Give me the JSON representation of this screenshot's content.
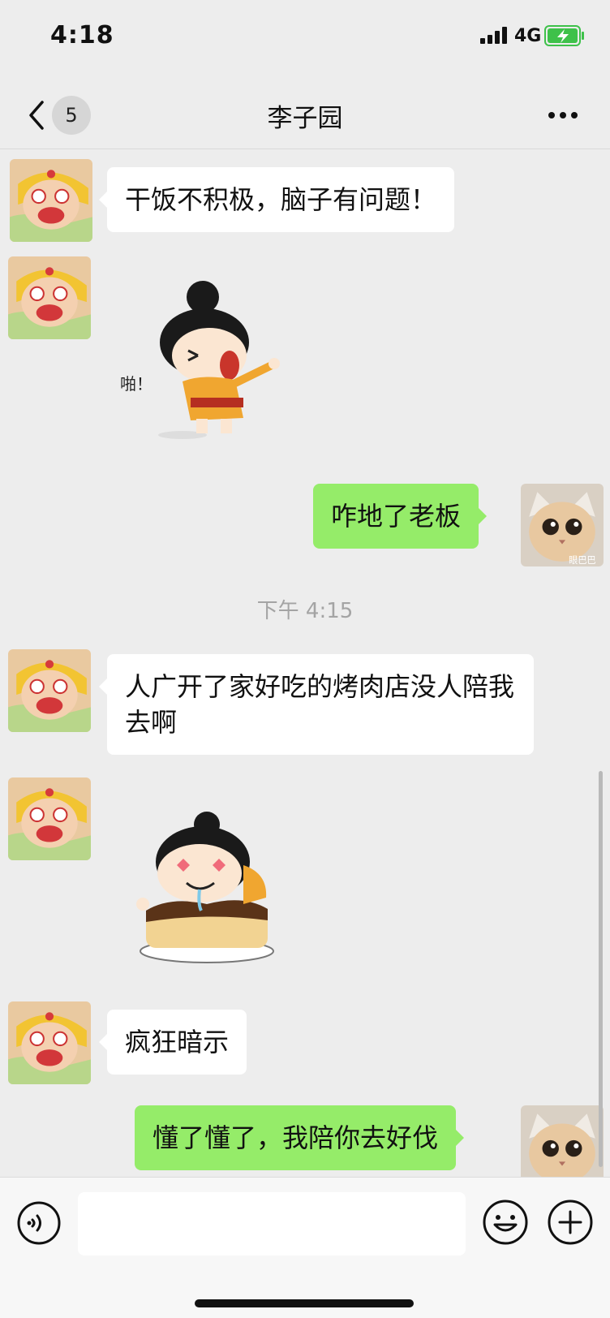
{
  "status_bar": {
    "time": "4:18",
    "network": "4G"
  },
  "nav": {
    "unread_count": "5",
    "title": "李子园"
  },
  "messages": [
    {
      "side": "left",
      "type": "text",
      "text": "干饭不积极，脑子有问题！"
    },
    {
      "side": "left",
      "type": "sticker",
      "icon": "slap-cartoon-sticker",
      "caption": "啪！"
    },
    {
      "side": "right",
      "type": "text",
      "text": "咋地了老板"
    },
    {
      "side": "left",
      "type": "text",
      "text": "人广开了家好吃的烤肉店没人陪我去啊"
    },
    {
      "side": "left",
      "type": "sticker",
      "icon": "drooling-over-cake-sticker"
    },
    {
      "side": "left",
      "type": "text",
      "text": "疯狂暗示"
    },
    {
      "side": "right",
      "type": "text",
      "text": "懂了懂了，我陪你去好伐"
    }
  ],
  "time_divider": "下午 4:15",
  "my_avatar_caption": "眼巴巴",
  "input": {
    "placeholder": "",
    "value": ""
  },
  "colors": {
    "background": "#ededed",
    "bubble_left": "#ffffff",
    "bubble_right": "#95ec69",
    "battery_charging": "#3ec14a"
  }
}
